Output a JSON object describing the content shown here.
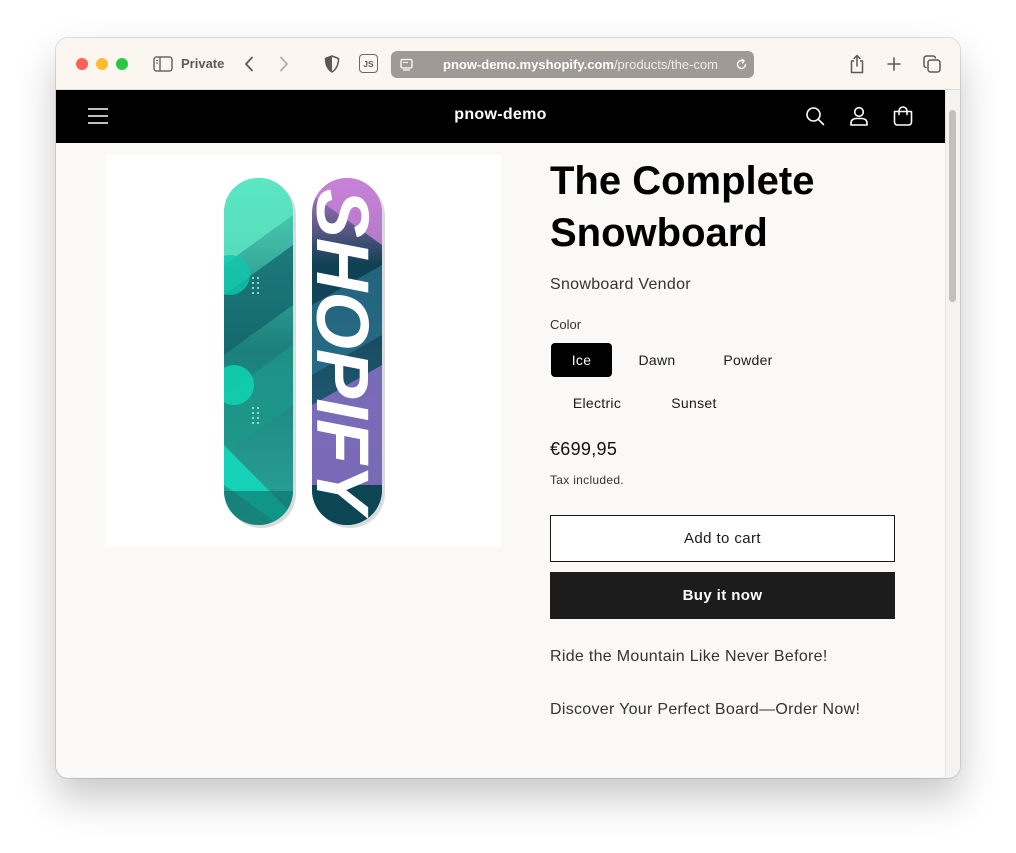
{
  "browser": {
    "mode_label": "Private",
    "js_label": "JS",
    "url_host": "pnow-demo.myshopify.com",
    "url_path": "/products/the-com"
  },
  "store": {
    "name": "pnow-demo"
  },
  "product": {
    "title": "The Complete Snowboard",
    "vendor": "Snowboard Vendor",
    "option_label": "Color",
    "variants": [
      "Ice",
      "Dawn",
      "Powder",
      "Electric",
      "Sunset"
    ],
    "selected_variant": "Ice",
    "price": "€699,95",
    "tax_note": "Tax included.",
    "add_to_cart": "Add to cart",
    "buy_now": "Buy it now",
    "description": [
      "Ride the Mountain Like Never Before!",
      "Discover Your Perfect Board—Order Now!"
    ],
    "board_graphic_text": "SHOPIFY"
  },
  "colors": {
    "store_header_bg": "#000000",
    "selected_variant_bg": "#000000",
    "buy_button_bg": "#1c1c1c",
    "page_bg": "#faf9f7"
  }
}
